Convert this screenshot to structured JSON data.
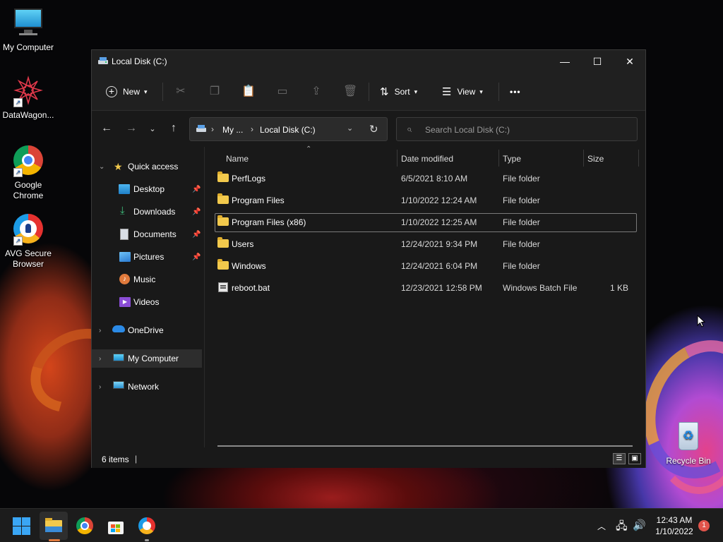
{
  "desktop": {
    "icons": [
      {
        "label": "My Computer",
        "icon": "monitor-icon"
      },
      {
        "label": "DataWagon...",
        "icon": "datawagon-icon"
      },
      {
        "label": "Google Chrome",
        "icon": "chrome-icon"
      },
      {
        "label": "AVG Secure Browser",
        "icon": "avg-browser-icon"
      },
      {
        "label": "Recycle Bin",
        "icon": "recycle-bin-icon"
      }
    ]
  },
  "window": {
    "title": "Local Disk (C:)",
    "controls": {
      "minimize": "—",
      "maximize": "☐",
      "close": "✕"
    }
  },
  "toolbar": {
    "new_label": "New",
    "sort_label": "Sort",
    "view_label": "View",
    "more_label": "•••",
    "icons": [
      "cut-icon",
      "copy-icon",
      "paste-icon",
      "rename-icon",
      "share-icon",
      "delete-icon"
    ]
  },
  "address": {
    "crumbs": [
      "My ...",
      "Local Disk (C:)"
    ],
    "search_placeholder": "Search Local Disk (C:)"
  },
  "sidebar": {
    "quick_access": "Quick access",
    "items": [
      {
        "label": "Desktop",
        "pinned": true
      },
      {
        "label": "Downloads",
        "pinned": true
      },
      {
        "label": "Documents",
        "pinned": true
      },
      {
        "label": "Pictures",
        "pinned": true
      },
      {
        "label": "Music",
        "pinned": false
      },
      {
        "label": "Videos",
        "pinned": false
      }
    ],
    "onedrive": "OneDrive",
    "my_computer": "My Computer",
    "network": "Network"
  },
  "columns": {
    "name": "Name",
    "date": "Date modified",
    "type": "Type",
    "size": "Size"
  },
  "files": [
    {
      "name": "PerfLogs",
      "date": "6/5/2021 8:10 AM",
      "type": "File folder",
      "size": "",
      "kind": "folder"
    },
    {
      "name": "Program Files",
      "date": "1/10/2022 12:24 AM",
      "type": "File folder",
      "size": "",
      "kind": "folder"
    },
    {
      "name": "Program Files (x86)",
      "date": "1/10/2022 12:25 AM",
      "type": "File folder",
      "size": "",
      "kind": "folder"
    },
    {
      "name": "Users",
      "date": "12/24/2021 9:34 PM",
      "type": "File folder",
      "size": "",
      "kind": "folder"
    },
    {
      "name": "Windows",
      "date": "12/24/2021 6:04 PM",
      "type": "File folder",
      "size": "",
      "kind": "folder"
    },
    {
      "name": "reboot.bat",
      "date": "12/23/2021 12:58 PM",
      "type": "Windows Batch File",
      "size": "1 KB",
      "kind": "bat"
    }
  ],
  "status": {
    "count": "6 items"
  },
  "taskbar": {
    "time": "12:43 AM",
    "date": "1/10/2022",
    "notifications": "1"
  }
}
